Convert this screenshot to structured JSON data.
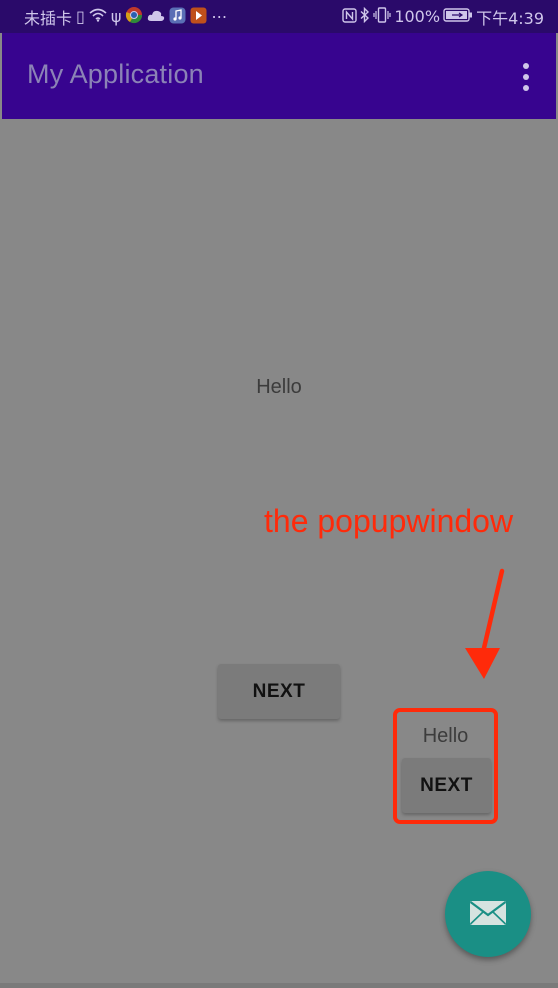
{
  "status_bar": {
    "carrier": "未插卡",
    "battery_percent": "100%",
    "time": "下午4:39",
    "left_icons": [
      "sim-icon",
      "wifi-icon",
      "usb-icon",
      "chrome-icon",
      "cloud-icon",
      "music-app-icon",
      "video-app-icon",
      "more-notifications-icon"
    ],
    "right_icons": [
      "nfc-icon",
      "bluetooth-icon",
      "vibrate-icon",
      "battery-icon"
    ]
  },
  "app_bar": {
    "title": "My Application",
    "menu_icon": "more-vert-icon"
  },
  "main": {
    "hello_text": "Hello",
    "next_label": "NEXT"
  },
  "annotation": {
    "text": "the popupwindow",
    "color": "#ff2a0a"
  },
  "popup": {
    "hello_text": "Hello",
    "next_label": "NEXT"
  },
  "fab": {
    "icon": "email-icon",
    "color": "#1a8f85"
  },
  "colors": {
    "status_bar": "#2a0a6a",
    "app_bar": "#37048f",
    "scrim_background": "#888888"
  }
}
